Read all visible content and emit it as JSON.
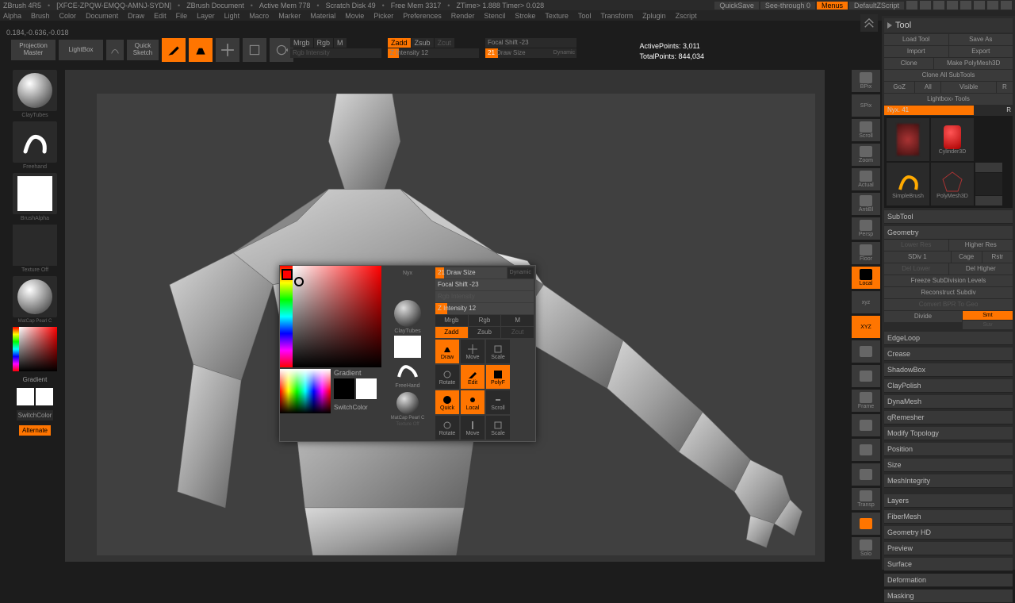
{
  "titlebar": {
    "app": "ZBrush 4R5",
    "session": "[XFCE-ZPQW-EMQQ-AMNJ-SYDN]",
    "doc": "ZBrush Document",
    "mem": "Active Mem 778",
    "scratch": "Scratch Disk 49",
    "free": "Free Mem 3317",
    "ztime": "ZTime> 1.888 Timer> 0.028",
    "quicksave": "QuickSave",
    "seethrough": "See-through   0",
    "menus": "Menus",
    "defaultscript": "DefaultZScript"
  },
  "menubar": [
    "Alpha",
    "Brush",
    "Color",
    "Document",
    "Draw",
    "Edit",
    "File",
    "Layer",
    "Light",
    "Macro",
    "Marker",
    "Material",
    "Movie",
    "Picker",
    "Preferences",
    "Render",
    "Stencil",
    "Stroke",
    "Texture",
    "Tool",
    "Transform",
    "Zplugin",
    "Zscript"
  ],
  "coords": "0.184,-0.636,-0.018",
  "top": {
    "projection": "Projection Master",
    "lightbox": "LightBox",
    "quicksketch": "Quick Sketch",
    "edit": "Edit",
    "draw": "Draw",
    "move": "Move",
    "scale": "Scale",
    "rotate": "Rotate",
    "mrgb": "Mrgb",
    "rgb": "Rgb",
    "m": "M",
    "rgbintensity": "Rgb Intensity",
    "zadd": "Zadd",
    "zsub": "Zsub",
    "zcut": "Zcut",
    "zintensity": "Z Intensity 12",
    "focalshift": "Focal Shift -23",
    "drawsize_val": "21",
    "drawsize_lbl": "Draw Size",
    "dynamic": "Dynamic",
    "activepoints": "ActivePoints: 3,011",
    "totalpoints": "TotalPoints: 844,034"
  },
  "leftpal": {
    "brush": "Freehand",
    "claytubes": "ClayTubes",
    "brushalpha": "BrushAlpha",
    "textureoff": "Texture Off",
    "matcap": "MatCap Pearl C",
    "gradient": "Gradient",
    "switchcolor": "SwitchColor",
    "alternate": "Alternate"
  },
  "rightnav": [
    "BPix",
    "SPix",
    "Scroll",
    "Zoom",
    "Actual",
    "AntiBl",
    "Persp",
    "Floor",
    "Local",
    "xyz",
    "XYZ",
    "",
    "",
    "Frame",
    "",
    "",
    "",
    "Transp",
    "",
    "Solo"
  ],
  "tool": {
    "title": "Tool",
    "loadtool": "Load Tool",
    "saveas": "Save As",
    "import": "Import",
    "export": "Export",
    "clone": "Clone",
    "polymesh3d": "Make PolyMesh3D",
    "cloneall": "Clone All SubTools",
    "goz": "GoZ",
    "all": "All",
    "visible": "Visible",
    "r": "R",
    "lightboxtools": "Lightbox› Tools",
    "nyx": "Nyx. 41",
    "thumbs": [
      "Nyx",
      "Cylinder3D",
      "SimpleBrush",
      "PolyMesh3D"
    ]
  },
  "subtool": "SubTool",
  "geometry": {
    "title": "Geometry",
    "lowerres": "Lower Res",
    "higherres": "Higher Res",
    "sdiv": "SDiv 1",
    "cage": "Cage",
    "rstr": "Rstr",
    "dellower": "Del Lower",
    "delhigher": "Del Higher",
    "freeze": "Freeze SubDivision Levels",
    "reconstruct": "Reconstruct Subdiv",
    "convertbpr": "Convert BPR To Geo",
    "smt": "Smt",
    "divide": "Divide",
    "suv": "Suv",
    "items": [
      "EdgeLoop",
      "Crease",
      "ShadowBox",
      "ClayPolish",
      "DynaMesh",
      "qRemesher",
      "Modify Topology",
      "Position",
      "Size",
      "MeshIntegrity"
    ]
  },
  "sections": [
    "Layers",
    "FiberMesh",
    "Geometry HD",
    "Preview",
    "Surface",
    "Deformation",
    "Masking"
  ],
  "popup": {
    "drawsize": "21 Draw Size",
    "dynamic": "Dynamic",
    "focalshift": "Focal Shift -23",
    "rgbintensity": "Rgb Intensity",
    "zintensity": "Z Intensity 12",
    "mrgb": "Mrgb",
    "rgb": "Rgb",
    "m": "M",
    "zadd": "Zadd",
    "zsub": "Zsub",
    "zcut": "Zcut",
    "icons": [
      "Draw",
      "Move",
      "Scale",
      "Rotate",
      "Edit",
      "PolyF",
      "Quick",
      "Local",
      "Scroll",
      "Rotate",
      "Move",
      "Scale"
    ],
    "gradient": "Gradient",
    "switchcolor": "SwitchColor",
    "nyx": "Nyx",
    "claytubes": "ClayTubes",
    "freehand": "FreeHand",
    "matcap": "MatCap Pearl C",
    "textureoff": "Texture Off"
  }
}
